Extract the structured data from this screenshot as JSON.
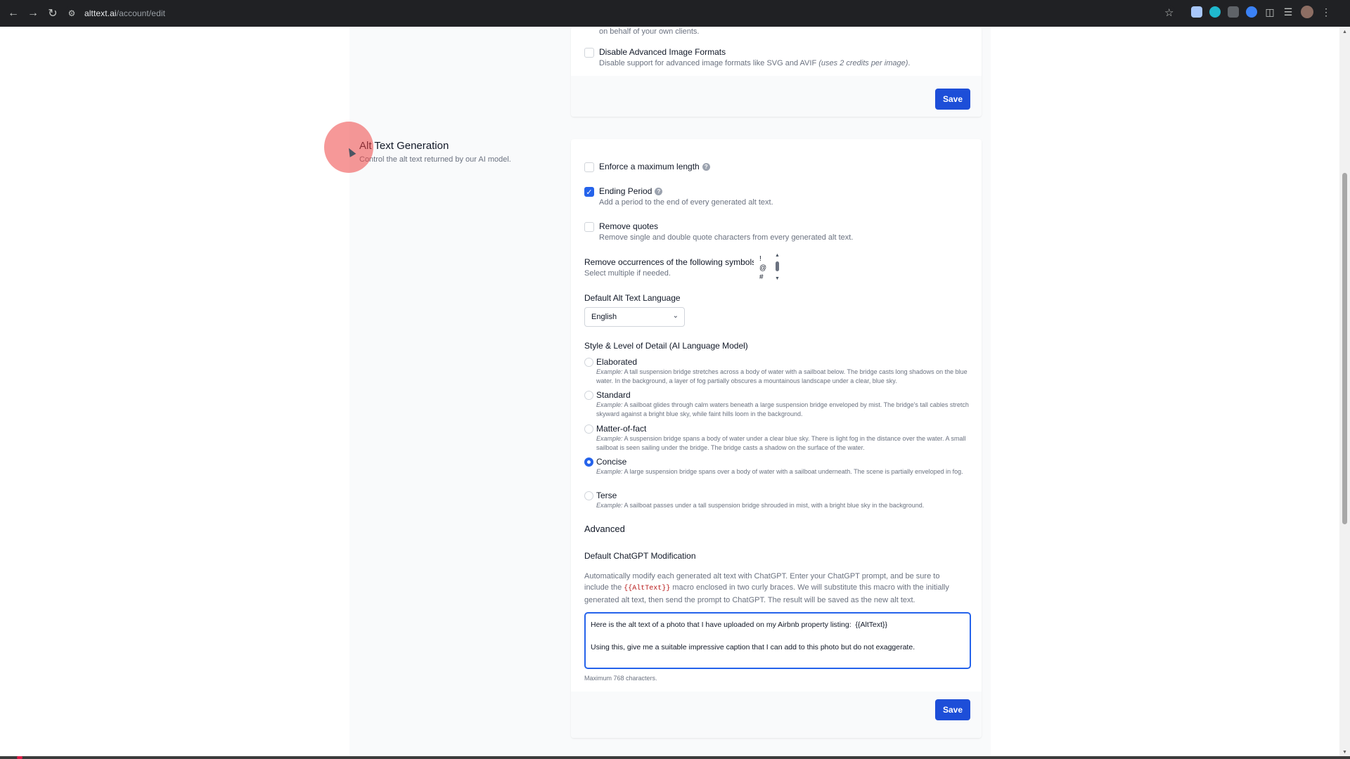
{
  "browser": {
    "url_host": "alttext.ai",
    "url_path": "/account/edit"
  },
  "top_card": {
    "clients_desc_tail": "on behalf of your own clients.",
    "disable_formats_label": "Disable Advanced Image Formats",
    "disable_formats_desc": "Disable support for advanced image formats like SVG and AVIF",
    "disable_formats_note": "(uses 2 credits per image)",
    "disable_formats_period": ".",
    "save_label": "Save"
  },
  "section": {
    "title": "Alt Text Generation",
    "subtitle": "Control the alt text returned by our AI model."
  },
  "options": {
    "max_length_label": "Enforce a maximum length",
    "ending_period_label": "Ending Period",
    "ending_period_desc": "Add a period to the end of every generated alt text.",
    "remove_quotes_label": "Remove quotes",
    "remove_quotes_desc": "Remove single and double quote characters from every generated alt text.",
    "symbols_label": "Remove occurrences of the following symbols:",
    "symbols_desc": "Select multiple if needed.",
    "symbols": [
      "!",
      "@",
      "#"
    ]
  },
  "language": {
    "label": "Default Alt Text Language",
    "selected": "English"
  },
  "style": {
    "label": "Style & Level of Detail (AI Language Model)",
    "example_prefix": "Example:",
    "levels": [
      {
        "name": "Elaborated",
        "example": "A tall suspension bridge stretches across a body of water with a sailboat below. The bridge casts long shadows on the blue water. In the background, a layer of fog partially obscures a mountainous landscape under a clear, blue sky.",
        "selected": false
      },
      {
        "name": "Standard",
        "example": "A sailboat glides through calm waters beneath a large suspension bridge enveloped by mist. The bridge's tall cables stretch skyward against a bright blue sky, while faint hills loom in the background.",
        "selected": false
      },
      {
        "name": "Matter-of-fact",
        "example": "A suspension bridge spans a body of water under a clear blue sky. There is light fog in the distance over the water. A small sailboat is seen sailing under the bridge. The bridge casts a shadow on the surface of the water.",
        "selected": false
      },
      {
        "name": "Concise",
        "example": "A large suspension bridge spans over a body of water with a sailboat underneath. The scene is partially enveloped in fog.",
        "selected": true
      },
      {
        "name": "Terse",
        "example": "A sailboat passes under a tall suspension bridge shrouded in mist, with a bright blue sky in the background.",
        "selected": false
      }
    ]
  },
  "advanced": {
    "heading": "Advanced",
    "chatgpt_label": "Default ChatGPT Modification",
    "chatgpt_desc_1": "Automatically modify each generated alt text with ChatGPT. Enter your ChatGPT prompt, and be sure to",
    "chatgpt_desc_2a": "include the",
    "chatgpt_macro": "{{AltText}}",
    "chatgpt_desc_2b": "macro enclosed in two curly braces. We will substitute this macro with the initially",
    "chatgpt_desc_3": "generated alt text, then send the prompt to ChatGPT. The result will be saved as the new alt text.",
    "prompt_value": "Here is the alt text of a photo that I have uploaded on my Airbnb property listing:  {{AltText}}\n\nUsing this, give me a suitable impressive caption that I can add to this photo but do not exaggerate.",
    "max_chars": "Maximum 768 characters.",
    "save_label": "Save"
  },
  "colors": {
    "accent": "#2563eb",
    "save_button": "#1d4ed8",
    "cursor_highlight": "#ef4444"
  }
}
